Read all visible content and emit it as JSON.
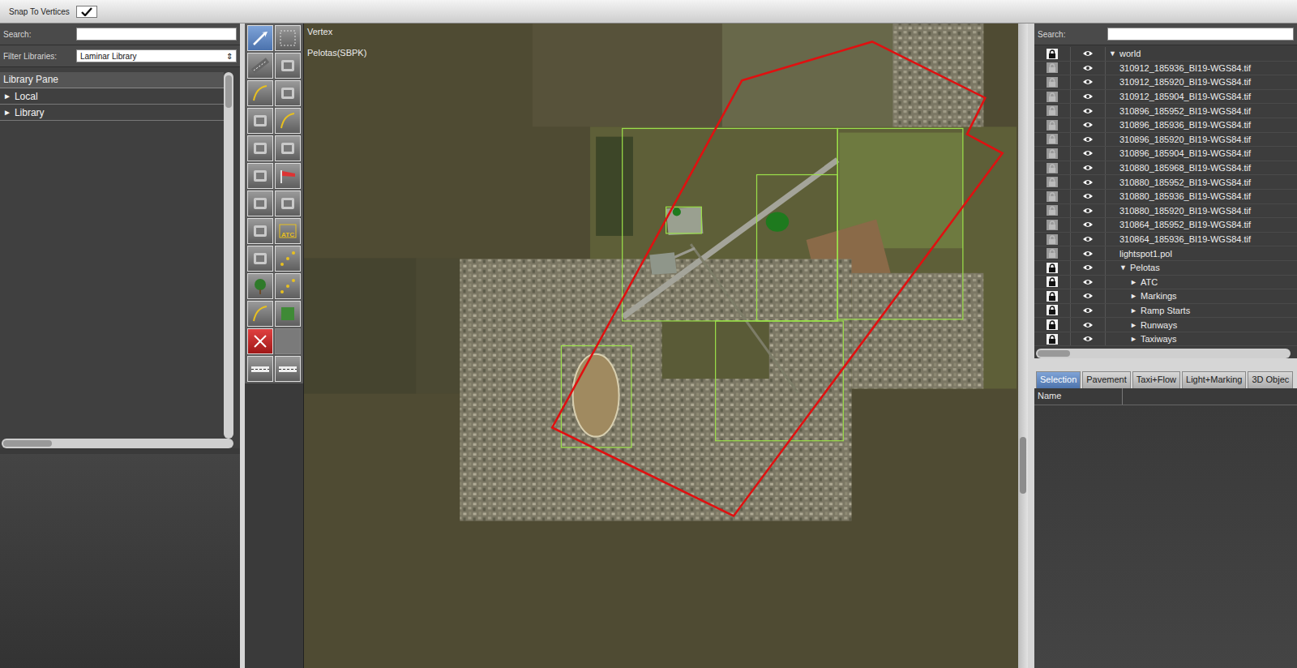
{
  "toolbar": {
    "snap_label": "Snap To Vertices",
    "snap_checked": true
  },
  "library": {
    "search_label": "Search:",
    "search_value": "",
    "filter_label": "Filter Libraries:",
    "filter_value": "Laminar Library",
    "filter_arrow": "⇕",
    "pane_title": "Library Pane",
    "items": [
      {
        "arrow": "►",
        "label": "Local",
        "expanded": false
      },
      {
        "arrow": "►",
        "label": "Library",
        "expanded": false
      }
    ]
  },
  "tools": [
    {
      "kind": "tool",
      "label": "",
      "selected": true
    },
    {
      "kind": "tool",
      "label": "",
      "selected": false
    },
    {
      "kind": "tool",
      "label": "",
      "selected": false
    },
    {
      "kind": "tool",
      "label": "",
      "selected": false
    },
    {
      "kind": "tool",
      "label": "",
      "selected": false
    },
    {
      "kind": "tool",
      "label": "",
      "selected": false
    },
    {
      "kind": "tool",
      "label": "",
      "selected": false
    },
    {
      "kind": "tool",
      "label": "",
      "selected": false
    },
    {
      "kind": "tool",
      "label": "",
      "selected": false
    },
    {
      "kind": "tool",
      "label": "",
      "selected": false
    },
    {
      "kind": "tool",
      "label": "",
      "selected": false
    },
    {
      "kind": "tool",
      "label": "",
      "selected": false
    },
    {
      "kind": "tool",
      "label": "",
      "selected": false
    },
    {
      "kind": "tool",
      "label": "",
      "selected": false
    },
    {
      "kind": "tool",
      "label": "",
      "selected": false
    },
    {
      "kind": "tool",
      "label": "ATC",
      "selected": false
    },
    {
      "kind": "tool",
      "label": "",
      "selected": false
    },
    {
      "kind": "tool",
      "label": "",
      "selected": false
    },
    {
      "kind": "tool",
      "label": "",
      "selected": false
    },
    {
      "kind": "tool",
      "label": "",
      "selected": false
    },
    {
      "kind": "tool",
      "label": "",
      "selected": false
    },
    {
      "kind": "tool",
      "label": "",
      "selected": false
    },
    {
      "kind": "tool",
      "label": "",
      "selected": false
    },
    {
      "kind": "blank",
      "label": "",
      "selected": false
    },
    {
      "kind": "tool",
      "label": "",
      "selected": false
    },
    {
      "kind": "tool",
      "label": "",
      "selected": false
    }
  ],
  "map": {
    "tool": "Vertex",
    "airport": "Pelotas(SBPK)"
  },
  "hierarchy": {
    "search_label": "Search:",
    "search_value": "",
    "rows": [
      {
        "depth": 0,
        "arrow": "▼",
        "name": "world",
        "locked": true,
        "visible": true
      },
      {
        "depth": 1,
        "arrow": "",
        "name": "310912_185936_BI19-WGS84.tif",
        "locked": false,
        "visible": true
      },
      {
        "depth": 1,
        "arrow": "",
        "name": "310912_185920_BI19-WGS84.tif",
        "locked": false,
        "visible": true
      },
      {
        "depth": 1,
        "arrow": "",
        "name": "310912_185904_BI19-WGS84.tif",
        "locked": false,
        "visible": true
      },
      {
        "depth": 1,
        "arrow": "",
        "name": "310896_185952_BI19-WGS84.tif",
        "locked": false,
        "visible": true
      },
      {
        "depth": 1,
        "arrow": "",
        "name": "310896_185936_BI19-WGS84.tif",
        "locked": false,
        "visible": true
      },
      {
        "depth": 1,
        "arrow": "",
        "name": "310896_185920_BI19-WGS84.tif",
        "locked": false,
        "visible": true
      },
      {
        "depth": 1,
        "arrow": "",
        "name": "310896_185904_BI19-WGS84.tif",
        "locked": false,
        "visible": true
      },
      {
        "depth": 1,
        "arrow": "",
        "name": "310880_185968_BI19-WGS84.tif",
        "locked": false,
        "visible": true
      },
      {
        "depth": 1,
        "arrow": "",
        "name": "310880_185952_BI19-WGS84.tif",
        "locked": false,
        "visible": true
      },
      {
        "depth": 1,
        "arrow": "",
        "name": "310880_185936_BI19-WGS84.tif",
        "locked": false,
        "visible": true
      },
      {
        "depth": 1,
        "arrow": "",
        "name": "310880_185920_BI19-WGS84.tif",
        "locked": false,
        "visible": true
      },
      {
        "depth": 1,
        "arrow": "",
        "name": "310864_185952_BI19-WGS84.tif",
        "locked": false,
        "visible": true
      },
      {
        "depth": 1,
        "arrow": "",
        "name": "310864_185936_BI19-WGS84.tif",
        "locked": false,
        "visible": true
      },
      {
        "depth": 1,
        "arrow": "",
        "name": "lightspot1.pol",
        "locked": false,
        "visible": true
      },
      {
        "depth": 1,
        "arrow": "▼",
        "name": "Pelotas",
        "locked": true,
        "visible": true
      },
      {
        "depth": 2,
        "arrow": "►",
        "name": "ATC",
        "locked": true,
        "visible": true
      },
      {
        "depth": 2,
        "arrow": "►",
        "name": "Markings",
        "locked": true,
        "visible": true
      },
      {
        "depth": 2,
        "arrow": "►",
        "name": "Ramp Starts",
        "locked": true,
        "visible": true
      },
      {
        "depth": 2,
        "arrow": "►",
        "name": "Runways",
        "locked": true,
        "visible": true
      },
      {
        "depth": 2,
        "arrow": "►",
        "name": "Taxiways",
        "locked": true,
        "visible": true
      }
    ]
  },
  "tabs": [
    {
      "label": "Selection",
      "selected": true
    },
    {
      "label": "Pavement",
      "selected": false
    },
    {
      "label": "Taxi+Flow",
      "selected": false
    },
    {
      "label": "Light+Marking",
      "selected": false
    },
    {
      "label": "3D Objec",
      "selected": false
    }
  ],
  "properties": {
    "columns": [
      "Name"
    ]
  }
}
